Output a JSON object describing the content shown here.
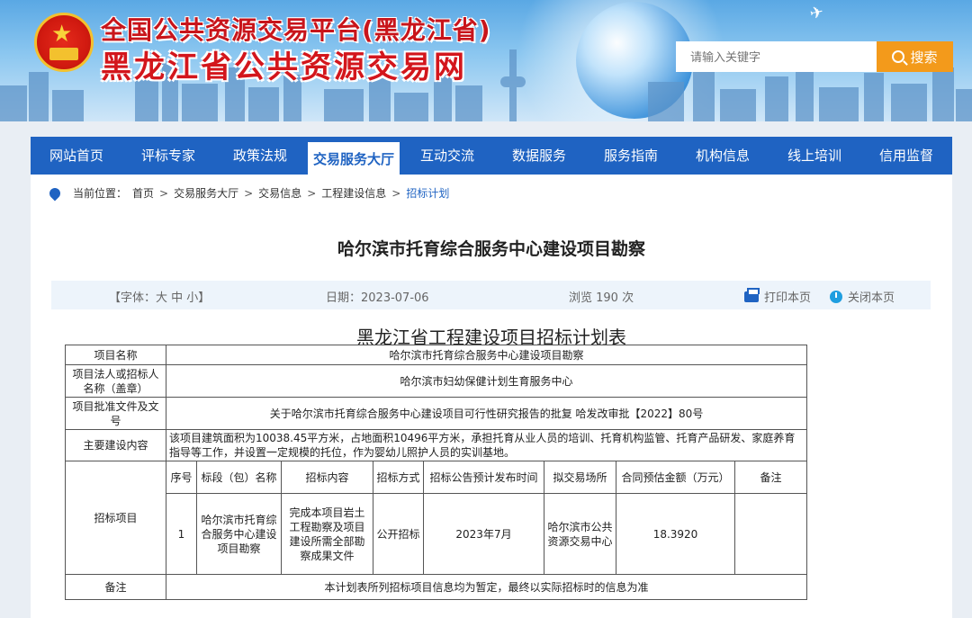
{
  "header": {
    "title_top": "全国公共资源交易平台(黑龙江省)",
    "title_main": "黑龙江省公共资源交易网",
    "search_placeholder": "请输入关键字",
    "search_button": "搜索"
  },
  "nav": {
    "items": [
      "网站首页",
      "评标专家",
      "政策法规",
      "交易服务大厅",
      "互动交流",
      "数据服务",
      "服务指南",
      "机构信息",
      "线上培训",
      "信用监督"
    ],
    "active": "交易服务大厅"
  },
  "breadcrumb": {
    "label": "当前位置：",
    "items": [
      "首页",
      "交易服务大厅",
      "交易信息",
      "工程建设信息",
      "招标计划"
    ],
    "separator": ">"
  },
  "article": {
    "title": "哈尔滨市托育综合服务中心建设项目勘察",
    "font_size_label": "【字体：大 中 小】",
    "date": "日期：2023-07-06",
    "views": "浏览 190 次",
    "print": "打印本页",
    "close": "关闭本页"
  },
  "plan_table": {
    "title": "黑龙江省工程建设项目招标计划表",
    "project_name_label": "项目名称",
    "project_name": "哈尔滨市托育综合服务中心建设项目勘察",
    "owner_label": "项目法人或招标人名称（盖章）",
    "owner": "哈尔滨市妇幼保健计划生育服务中心",
    "approval_label": "项目批准文件及文号",
    "approval": "关于哈尔滨市托育综合服务中心建设项目可行性研究报告的批复 哈发改审批【2022】80号",
    "content_label": "主要建设内容",
    "content": "该项目建筑面积为10038.45平方米，占地面积10496平方米，承担托育从业人员的培训、托育机构监管、托育产品研发、家庭养育指导等工作，并设置一定规模的托位，作为婴幼儿照护人员的实训基地。",
    "bid_items_label": "招标项目",
    "columns": [
      "序号",
      "标段（包）名称",
      "招标内容",
      "招标方式",
      "招标公告预计发布时间",
      "拟交易场所",
      "合同预估金额（万元）",
      "备注"
    ],
    "rows": [
      [
        "1",
        "哈尔滨市托育综合服务中心建设项目勘察",
        "完成本项目岩土工程勘察及项目建设所需全部勘察成果文件",
        "公开招标",
        "2023年7月",
        "哈尔滨市公共资源交易中心",
        "18.3920",
        ""
      ]
    ],
    "remarks_label": "备注",
    "remarks": "本计划表所列招标项目信息均为暂定，最终以实际招标时的信息为准"
  }
}
